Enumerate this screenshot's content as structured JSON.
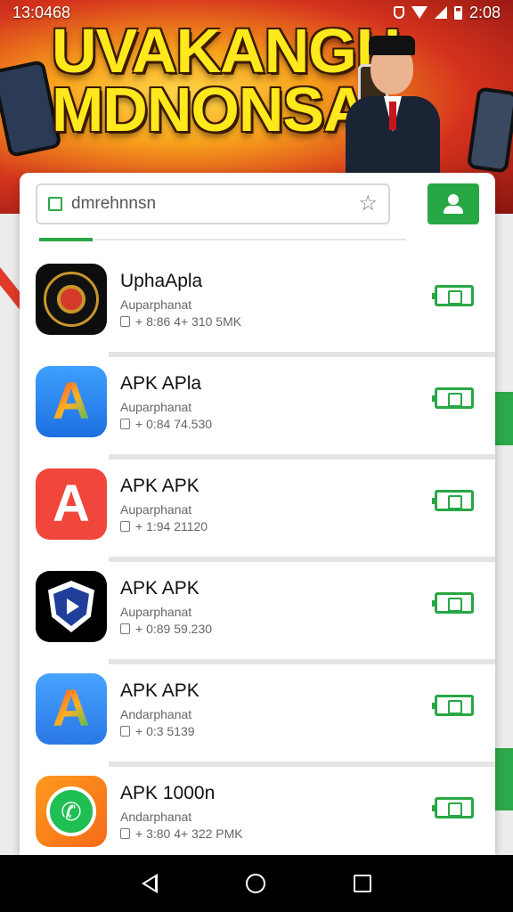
{
  "status_bar": {
    "time": "13:0468",
    "right_text": "2:08"
  },
  "banner": {
    "title": "UVAKANGH MDNONSA!"
  },
  "search": {
    "placeholder": "",
    "value": "dmrehnnsn"
  },
  "apps": [
    {
      "name": "UphaApla",
      "subtitle": "Auparphanat",
      "meta": "+ 8:86 4+ 310 5MK",
      "icon": "emblem-icon"
    },
    {
      "name": "APK  APla",
      "subtitle": "Auparphanat",
      "meta": "+ 0:84 74.530",
      "icon": "a-blue-icon"
    },
    {
      "name": "APK APK",
      "subtitle": "Auparphanat",
      "meta": "+ 1:94 21120",
      "icon": "a-red-icon"
    },
    {
      "name": "APK APK",
      "subtitle": "Auparphanat",
      "meta": "+ 0:89 59.230",
      "icon": "shield-play-icon"
    },
    {
      "name": "APK APK",
      "subtitle": "Andarphanat",
      "meta": "+ 0:3 5139",
      "icon": "a-multicolor-icon"
    },
    {
      "name": "APK 1000n",
      "subtitle": "Andarphanat",
      "meta": "+ 3:80 4+ 322 PMK",
      "icon": "whatsapp-icon"
    }
  ],
  "colors": {
    "accent": "#28a745",
    "banner_red": "#d4321d",
    "banner_yellow": "#ffe81c"
  }
}
